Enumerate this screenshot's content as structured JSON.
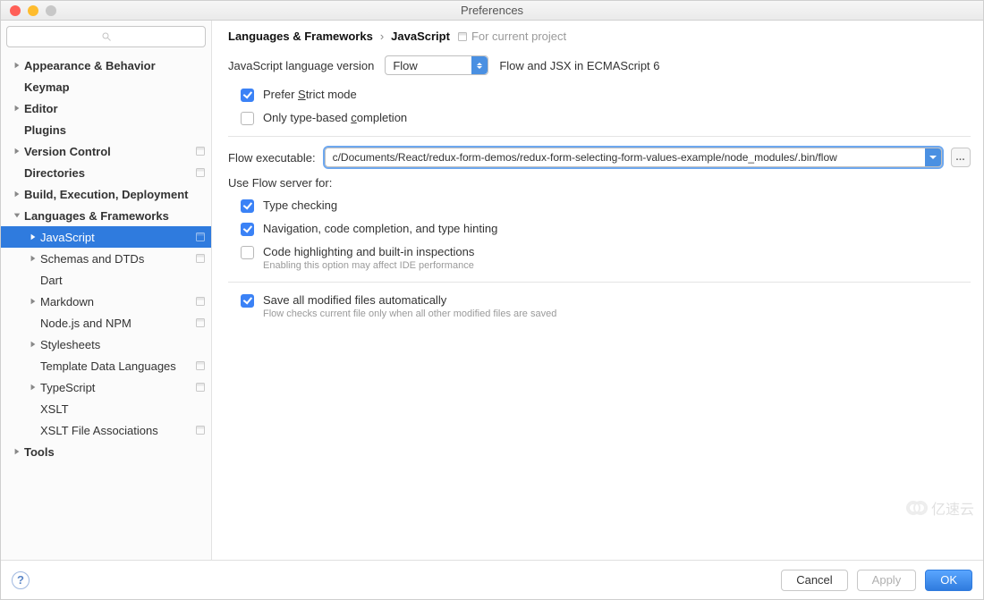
{
  "window": {
    "title": "Preferences"
  },
  "search": {
    "placeholder": ""
  },
  "sidebar": [
    {
      "label": "Appearance & Behavior",
      "depth": 0,
      "expand": "right",
      "bold": true
    },
    {
      "label": "Keymap",
      "depth": 0,
      "expand": "none",
      "bold": true
    },
    {
      "label": "Editor",
      "depth": 0,
      "expand": "right",
      "bold": true
    },
    {
      "label": "Plugins",
      "depth": 0,
      "expand": "none",
      "bold": true
    },
    {
      "label": "Version Control",
      "depth": 0,
      "expand": "right",
      "bold": true,
      "badge": true
    },
    {
      "label": "Directories",
      "depth": 0,
      "expand": "none",
      "bold": true,
      "badge": true
    },
    {
      "label": "Build, Execution, Deployment",
      "depth": 0,
      "expand": "right",
      "bold": true
    },
    {
      "label": "Languages & Frameworks",
      "depth": 0,
      "expand": "down",
      "bold": true
    },
    {
      "label": "JavaScript",
      "depth": 1,
      "expand": "right",
      "selected": true,
      "badge": true
    },
    {
      "label": "Schemas and DTDs",
      "depth": 1,
      "expand": "right",
      "badge": true
    },
    {
      "label": "Dart",
      "depth": 1,
      "expand": "none"
    },
    {
      "label": "Markdown",
      "depth": 1,
      "expand": "right",
      "badge": true
    },
    {
      "label": "Node.js and NPM",
      "depth": 1,
      "expand": "none",
      "badge": true
    },
    {
      "label": "Stylesheets",
      "depth": 1,
      "expand": "right"
    },
    {
      "label": "Template Data Languages",
      "depth": 1,
      "expand": "none",
      "badge": true
    },
    {
      "label": "TypeScript",
      "depth": 1,
      "expand": "right",
      "badge": true
    },
    {
      "label": "XSLT",
      "depth": 1,
      "expand": "none"
    },
    {
      "label": "XSLT File Associations",
      "depth": 1,
      "expand": "none",
      "badge": true
    },
    {
      "label": "Tools",
      "depth": 0,
      "expand": "right",
      "bold": true
    }
  ],
  "breadcrumb": {
    "a": "Languages & Frameworks",
    "b": "JavaScript",
    "scope": "For current project"
  },
  "form": {
    "langversion_label": "JavaScript language version",
    "langversion_value": "Flow",
    "langversion_hint": "Flow and JSX in ECMAScript 6",
    "strict_pre": "Prefer ",
    "strict_s": "S",
    "strict_post": "trict mode",
    "typebased_pre": "Only type-based ",
    "typebased_c": "c",
    "typebased_post": "ompletion",
    "exec_label": "Flow executable:",
    "exec_value": "c/Documents/React/redux-form-demos/redux-form-selecting-form-values-example/node_modules/.bin/flow",
    "useflow_label": "Use Flow server for:",
    "opts": {
      "a": "Type checking",
      "b": "Navigation, code completion, and type hinting",
      "c": "Code highlighting and built-in inspections",
      "c_note": "Enabling this option may affect IDE performance"
    },
    "save_label": "Save all modified files automatically",
    "save_note": "Flow checks current file only when all other modified files are saved"
  },
  "footer": {
    "cancel": "Cancel",
    "apply": "Apply",
    "ok": "OK"
  },
  "watermark": "亿速云"
}
